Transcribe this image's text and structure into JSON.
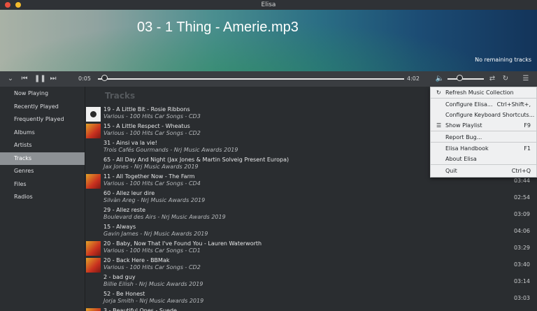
{
  "window": {
    "title": "Elisa"
  },
  "now_playing": {
    "title": "03 - 1 Thing - Amerie.mp3",
    "remaining": "No remaining tracks"
  },
  "player": {
    "elapsed": "0:05",
    "duration": "4:02",
    "progress": 0.021,
    "volume": 0.28
  },
  "sidebar": {
    "items": [
      {
        "label": "Now Playing"
      },
      {
        "label": "Recently Played"
      },
      {
        "label": "Frequently Played"
      },
      {
        "label": "Albums"
      },
      {
        "label": "Artists"
      },
      {
        "label": "Tracks"
      },
      {
        "label": "Genres"
      },
      {
        "label": "Files"
      },
      {
        "label": "Radios"
      }
    ],
    "active_index": 5
  },
  "main": {
    "header": "Tracks",
    "tracks": [
      {
        "title": "19 - A Little Bit - Rosie Ribbons",
        "subtitle": "Various - 100 Hits Car Songs - CD3",
        "duration": "",
        "art": "coffee"
      },
      {
        "title": "15 - A Little Respect - Wheatus",
        "subtitle": "Various - 100 Hits Car Songs - CD2",
        "duration": "",
        "art": "yellow"
      },
      {
        "title": "31 - Ainsi va la vie!",
        "subtitle": "Trois Cafés Gourmands - Nrj Music Awards 2019",
        "duration": "",
        "art": ""
      },
      {
        "title": "65 - All Day And Night (Jax Jones & Martin Solveig Present Europa)",
        "subtitle": "Jax Jones - Nrj Music Awards 2019",
        "duration": "",
        "art": ""
      },
      {
        "title": "11 - All Together Now - The Farm",
        "subtitle": "Various - 100 Hits Car Songs - CD4",
        "duration": "03:44",
        "art": "yellow"
      },
      {
        "title": "60 - Allez leur dire",
        "subtitle": "Silvàn Areg - Nrj Music Awards 2019",
        "duration": "02:54",
        "art": ""
      },
      {
        "title": "29 - Allez reste",
        "subtitle": "Boulevard des Airs - Nrj Music Awards 2019",
        "duration": "03:09",
        "art": ""
      },
      {
        "title": "15 - Always",
        "subtitle": "Gavin James - Nrj Music Awards 2019",
        "duration": "04:06",
        "art": ""
      },
      {
        "title": "20 - Baby, Now That I've Found You - Lauren Waterworth",
        "subtitle": "Various - 100 Hits Car Songs - CD1",
        "duration": "03:29",
        "art": "yellow"
      },
      {
        "title": "20 - Back Here - BBMak",
        "subtitle": "Various - 100 Hits Car Songs - CD2",
        "duration": "03:40",
        "art": "yellow"
      },
      {
        "title": "2 - bad guy",
        "subtitle": "Billie Eilish - Nrj Music Awards 2019",
        "duration": "03:14",
        "art": ""
      },
      {
        "title": "52 - Be Honest",
        "subtitle": "Jorja Smith - Nrj Music Awards 2019",
        "duration": "03:03",
        "art": ""
      },
      {
        "title": "3 - Beautiful Ones - Suede",
        "subtitle": "",
        "duration": "",
        "art": "yellow"
      }
    ]
  },
  "menu": {
    "items": [
      {
        "label": "Refresh Music Collection",
        "shortcut": "",
        "icon": "refresh-icon"
      },
      {
        "label": "Configure Elisa...",
        "shortcut": "Ctrl+Shift+,",
        "icon": ""
      },
      {
        "label": "Configure Keyboard Shortcuts...",
        "shortcut": "",
        "icon": ""
      },
      {
        "label": "Show Playlist",
        "shortcut": "F9",
        "icon": "playlist-icon"
      },
      {
        "label": "Report Bug...",
        "shortcut": "",
        "icon": ""
      },
      {
        "label": "Elisa Handbook",
        "shortcut": "F1",
        "icon": ""
      },
      {
        "label": "About Elisa",
        "shortcut": "",
        "icon": ""
      },
      {
        "label": "Quit",
        "shortcut": "Ctrl+Q",
        "icon": ""
      }
    ]
  },
  "colors": {
    "accent_selected": "#8d9195",
    "background": "#2a2d30",
    "menu_bg": "#eff0f1"
  }
}
